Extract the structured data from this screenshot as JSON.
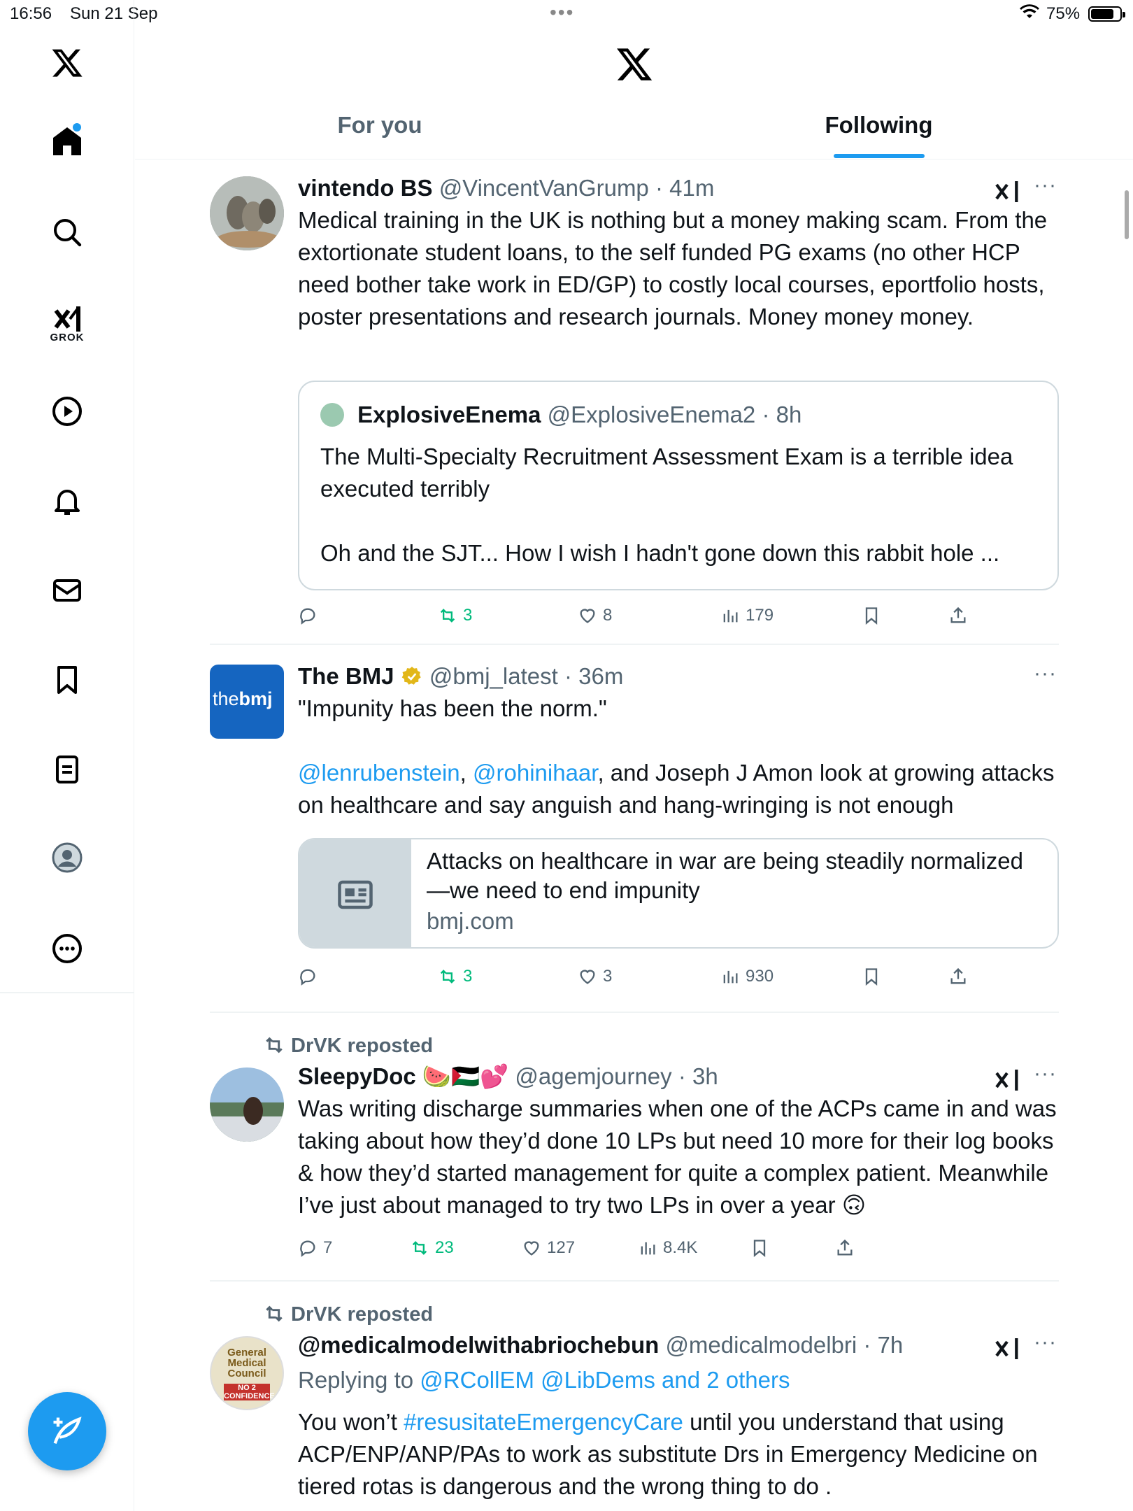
{
  "status_bar": {
    "time": "16:56",
    "date": "Sun 21 Sep",
    "battery": "75%"
  },
  "sidebar": {
    "items": [
      {
        "icon": "x-logo-icon"
      },
      {
        "icon": "home-icon"
      },
      {
        "icon": "search-icon"
      },
      {
        "icon": "grok-icon",
        "label": "GROK"
      },
      {
        "icon": "video-icon"
      },
      {
        "icon": "notifications-icon"
      },
      {
        "icon": "messages-icon"
      },
      {
        "icon": "bookmarks-icon"
      },
      {
        "icon": "lists-icon"
      },
      {
        "icon": "profile-icon"
      },
      {
        "icon": "more-icon"
      }
    ],
    "compose": "compose-icon"
  },
  "header": {
    "tabs": [
      "For you",
      "Following"
    ],
    "active_tab": "Following"
  },
  "feed": {
    "posts": [
      {
        "name": "vintendo BS",
        "handle": "@VincentVanGrump",
        "sep": "·",
        "time": "41m",
        "text": "Medical training in the UK is nothing but a money making scam. From the extortionate student loans, to the self funded PG exams (no other HCP need bother take work in ED/GP) to costly local courses, eportfolio hosts, poster presentations and research journals. Money money money.",
        "quote": {
          "name": "ExplosiveEnema",
          "handle": "@ExplosiveEnema2",
          "sep": "·",
          "time": "8h",
          "text_1": "The Multi-Specialty Recruitment Assessment Exam is a terrible idea executed terribly",
          "text_2": "Oh and the SJT... How I wish I hadn't gone down this rabbit hole ..."
        },
        "replies": "",
        "reposts": "3",
        "likes": "8",
        "views": "179"
      },
      {
        "name": "The BMJ",
        "handle": "@bmj_latest",
        "sep": "·",
        "time": "36m",
        "avatar_text_1": "the",
        "avatar_text_2": "bmj",
        "text_1": "\"Impunity has been the norm.\"",
        "mention_1": "@lenrubenstein",
        "comma": ",",
        "mention_2": "@rohinihaar",
        "text_2": ", and Joseph J Amon look at growing attacks on healthcare and say anguish and hang-wringing is not enough",
        "card": {
          "title": "Attacks on healthcare in war are being steadily normalized—we need to end impunity",
          "domain": "bmj.com"
        },
        "replies": "",
        "reposts": "3",
        "likes": "3",
        "views": "930"
      },
      {
        "reposted_by": "DrVK reposted",
        "name": "SleepyDoc",
        "emojis": "🍉🇵🇸💕",
        "handle": "@agemjourney",
        "sep": "·",
        "time": "3h",
        "text": "Was writing discharge summaries when one of the ACPs came in and was taking about how they’d done 10 LPs but need 10 more for their log books & how they’d started management for quite a complex patient. Meanwhile I’ve just about managed to try two LPs in over a year 🙃",
        "replies": "7",
        "reposts": "23",
        "likes": "127",
        "views": "8.4K"
      },
      {
        "reposted_by": "DrVK reposted",
        "name": "@medicalmodelwithabriochebun",
        "handle": "@medicalmodelbri",
        "sep": "·",
        "time": "7h",
        "avatar_text": "General Medical Council",
        "avatar_text_2": "NO 2 CONFIDENCE",
        "replying_label": "Replying to",
        "replying_to": "@RCollEM @LibDems and 2 others",
        "text_pre": "You won’t ",
        "hashtag": "#resusitateEmergencyCare",
        "text_post": " until you understand that using ACP/ENP/ANP/PAs to work as substitute Drs in Emergency Medicine on tiered rotas is dangerous and the wrong thing to do ."
      }
    ]
  },
  "colors": {
    "accent": "#1d9bf0",
    "repost_green": "#00ba7c",
    "secondary_text": "#536471"
  }
}
